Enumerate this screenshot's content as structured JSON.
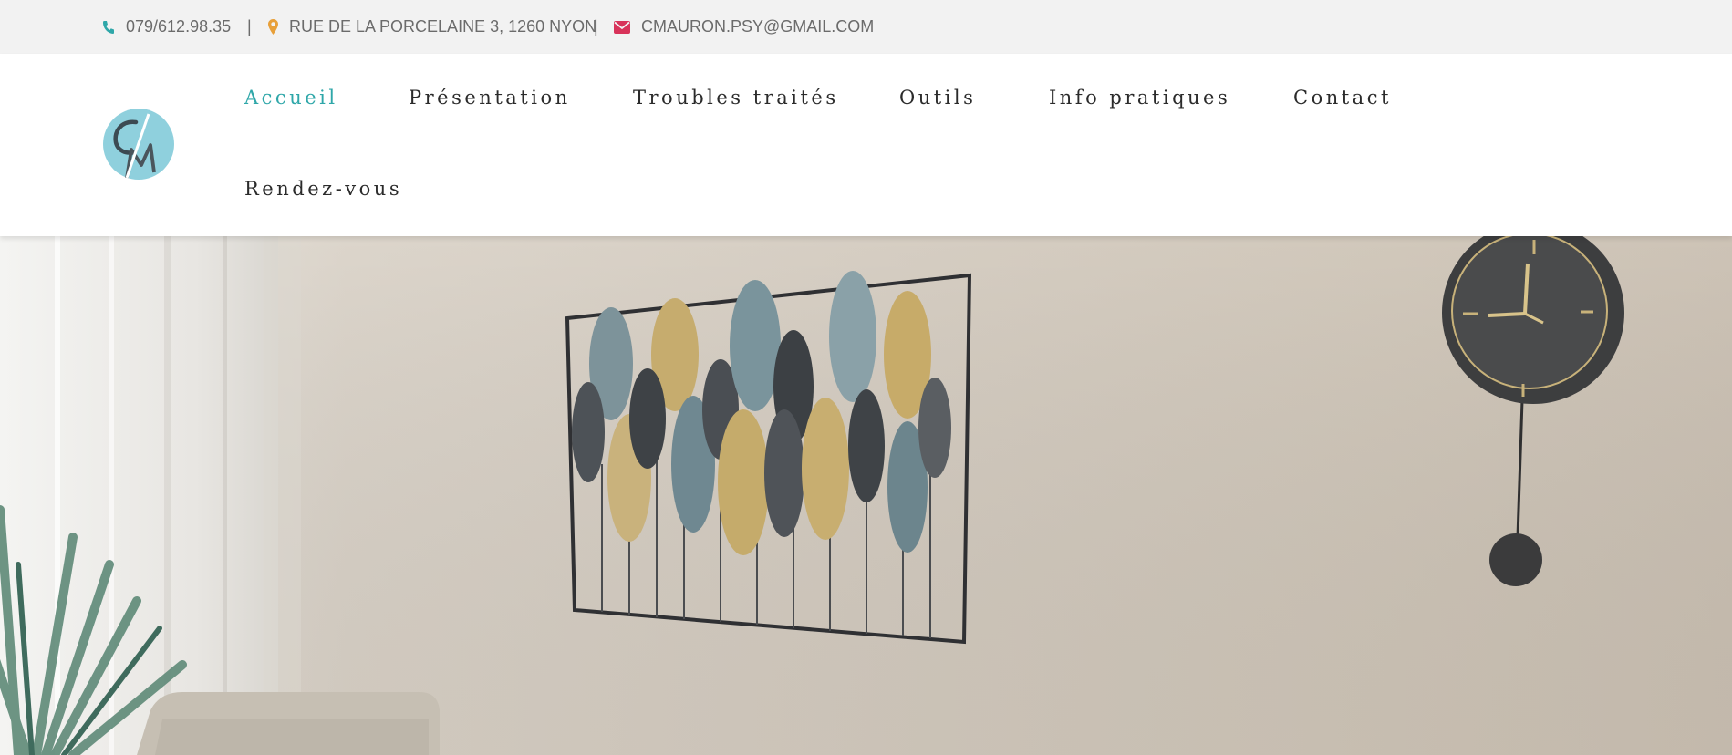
{
  "topbar": {
    "phone": "079/612.98.35",
    "separator": "|",
    "address": "RUE DE LA PORCELAINE 3, 1260 NYON",
    "email": "CMAURON.PSY@GMAIL.COM",
    "icons": [
      "phone-icon",
      "map-pin-icon",
      "envelope-icon"
    ],
    "icon_colors": {
      "phone": "#2fa7a9",
      "pin": "#e8a03a",
      "email": "#d8335a"
    }
  },
  "nav": {
    "items": [
      {
        "label": "Accueil",
        "active": true
      },
      {
        "label": "Présentation",
        "active": false
      },
      {
        "label": "Troubles traités",
        "active": false
      },
      {
        "label": "Outils",
        "active": false
      },
      {
        "label": "Info pratiques",
        "active": false
      },
      {
        "label": "Contact",
        "active": false
      },
      {
        "label": "Rendez-vous",
        "active": false
      }
    ],
    "accent_color": "#2fa7a9",
    "text_color": "#2b2b2b"
  },
  "logo": {
    "icon": "cm-monogram-logo",
    "color": "#8fd0dd"
  },
  "hero": {
    "icon": "office-wall-photo"
  }
}
